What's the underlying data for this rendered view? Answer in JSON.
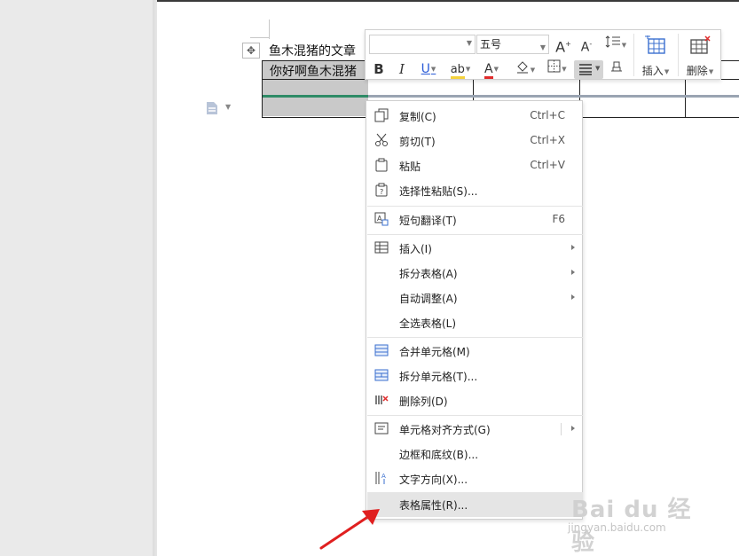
{
  "document": {
    "title": "鱼木混猪的文章",
    "cell_text": "你好啊鱼木混猪"
  },
  "toolbar": {
    "font_name": "",
    "font_size": "五号",
    "bold": "B",
    "italic": "I",
    "underline": "U",
    "highlight": "ab",
    "font_color": "A",
    "grow_font": "A",
    "shrink_font": "A",
    "insert_label": "插入",
    "delete_label": "删除"
  },
  "context_menu": {
    "items": [
      {
        "icon": "copy-icon",
        "label": "复制(C)",
        "shortcut": "Ctrl+C"
      },
      {
        "icon": "cut-icon",
        "label": "剪切(T)",
        "shortcut": "Ctrl+X"
      },
      {
        "icon": "paste-icon",
        "label": "粘贴",
        "shortcut": "Ctrl+V"
      },
      {
        "icon": "paste-special-icon",
        "label": "选择性粘贴(S)..."
      },
      {
        "icon": "translate-icon",
        "label": "短句翻译(T)",
        "shortcut": "F6"
      },
      {
        "icon": "insert-table-icon",
        "label": "插入(I)"
      },
      {
        "label": "拆分表格(A)"
      },
      {
        "label": "自动调整(A)"
      },
      {
        "label": "全选表格(L)"
      },
      {
        "icon": "merge-cells-icon",
        "label": "合并单元格(M)"
      },
      {
        "icon": "split-cells-icon",
        "label": "拆分单元格(T)..."
      },
      {
        "icon": "delete-column-icon",
        "label": "删除列(D)"
      },
      {
        "icon": "cell-align-icon",
        "label": "单元格对齐方式(G)"
      },
      {
        "label": "边框和底纹(B)..."
      },
      {
        "icon": "text-direction-icon",
        "label": "文字方向(X)..."
      },
      {
        "label": "表格属性(R)..."
      }
    ]
  },
  "watermark": {
    "main": "Bai du 经验",
    "sub": "jingyan.baidu.com"
  },
  "colors": {
    "highlight_yellow": "#f4d23c",
    "font_red": "#e02b2b",
    "table_green": "#2e8b66",
    "arrow_red": "#e01f1f",
    "hover_gray": "#e5e5e5"
  }
}
